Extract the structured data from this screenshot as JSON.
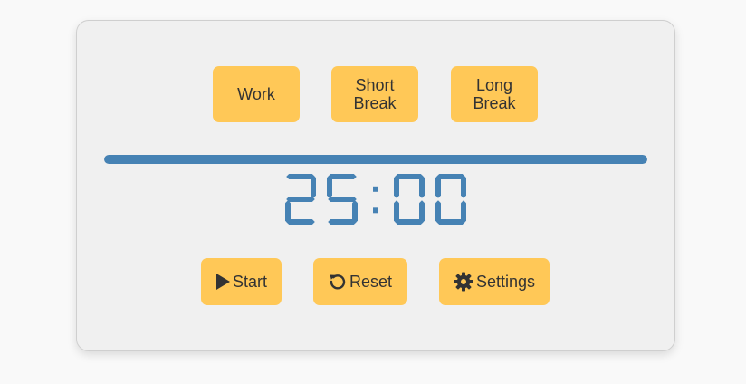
{
  "modes": {
    "work_label": "Work",
    "short_break_label": "Short\nBreak",
    "long_break_label": "Long\nBreak"
  },
  "progress": {
    "fraction": 1.0,
    "color": "#4682b4"
  },
  "timer": {
    "display": "25:00",
    "color": "#4682b4"
  },
  "controls": {
    "start_label": "Start",
    "start_icon": "play-icon",
    "reset_label": "Reset",
    "reset_icon": "reset-icon",
    "settings_label": "Settings",
    "settings_icon": "gear-icon"
  },
  "colors": {
    "button_bg": "#ffc857",
    "card_bg": "#f0f0f0",
    "text": "#333333"
  }
}
